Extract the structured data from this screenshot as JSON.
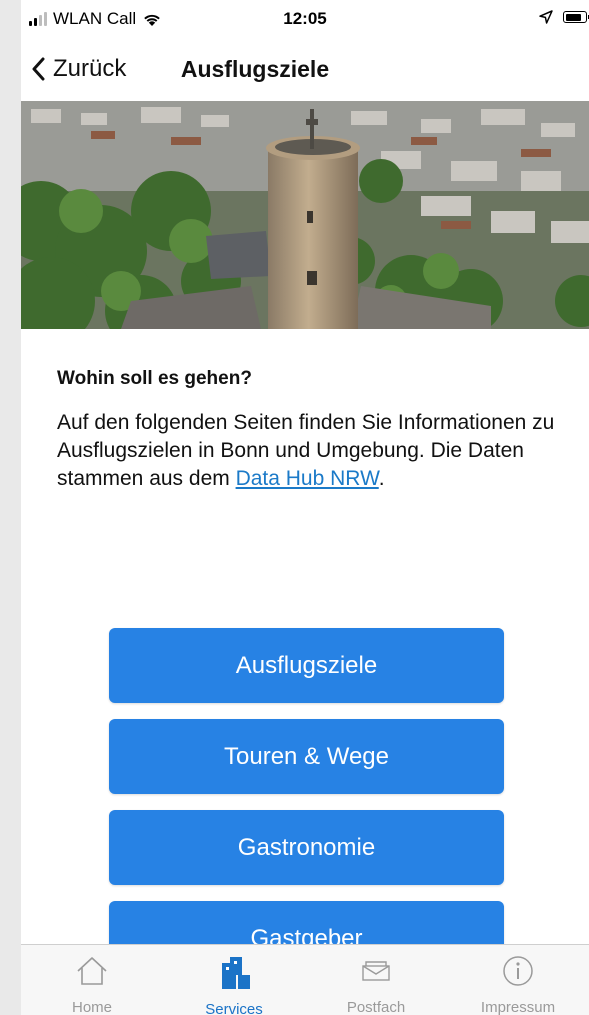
{
  "status_bar": {
    "carrier": "WLAN Call",
    "time": "12:05",
    "signal_icon": "signal-bars-icon",
    "wifi_icon": "wifi-icon",
    "location_icon": "location-arrow-icon",
    "battery_icon": "battery-icon",
    "battery_level": 0.85
  },
  "nav": {
    "back_label": "Zurück",
    "title": "Ausflugsziele"
  },
  "content": {
    "heading": "Wohin soll es gehen?",
    "intro_text": "Auf den folgenden Seiten finden Sie Informationen zu Ausflugszielen in Bonn und Umgebung. Die Daten stammen aus dem ",
    "link_text": "Data Hub NRW",
    "intro_end": "."
  },
  "buttons": [
    {
      "label": "Ausflugsziele"
    },
    {
      "label": "Touren & Wege"
    },
    {
      "label": "Gastronomie"
    },
    {
      "label": "Gastgeber"
    }
  ],
  "tabbar": {
    "active": "Services",
    "tabs": [
      {
        "label": "Home",
        "icon": "home-icon"
      },
      {
        "label": "Services",
        "icon": "buildings-icon"
      },
      {
        "label": "Postfach",
        "icon": "envelope-icon"
      },
      {
        "label": "Impressum",
        "icon": "info-icon"
      }
    ]
  },
  "colors": {
    "button_blue": "#2782e4",
    "link_blue": "#1b7ac8",
    "tab_active": "#1b73c7",
    "tab_inactive": "#9a9a9a"
  }
}
